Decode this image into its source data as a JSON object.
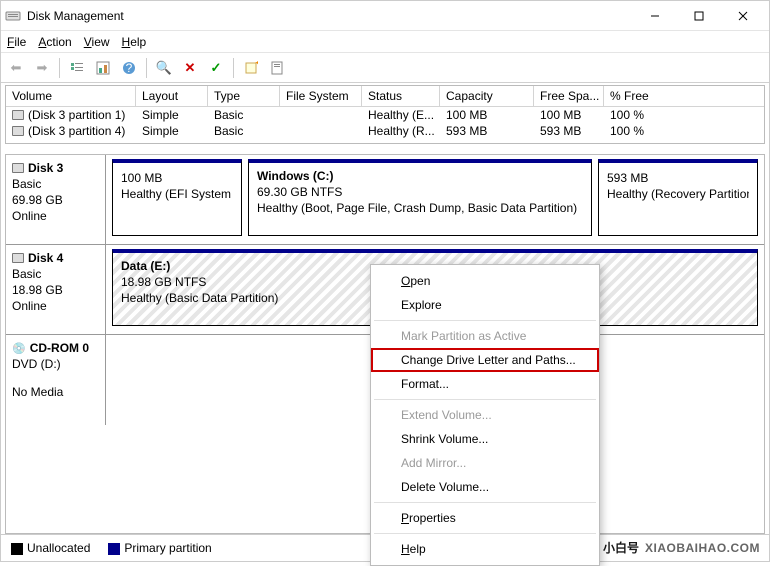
{
  "window": {
    "title": "Disk Management"
  },
  "menu": {
    "file": "File",
    "action": "Action",
    "view": "View",
    "help": "Help"
  },
  "columns": {
    "volume": "Volume",
    "layout": "Layout",
    "type": "Type",
    "filesystem": "File System",
    "status": "Status",
    "capacity": "Capacity",
    "freespace": "Free Spa...",
    "pctfree": "% Free"
  },
  "rows": [
    {
      "volume": "(Disk 3 partition 1)",
      "layout": "Simple",
      "type": "Basic",
      "filesystem": "",
      "status": "Healthy (E...",
      "capacity": "100 MB",
      "freespace": "100 MB",
      "pctfree": "100 %"
    },
    {
      "volume": "(Disk 3 partition 4)",
      "layout": "Simple",
      "type": "Basic",
      "filesystem": "",
      "status": "Healthy (R...",
      "capacity": "593 MB",
      "freespace": "593 MB",
      "pctfree": "100 %"
    }
  ],
  "disks": {
    "d3": {
      "name": "Disk 3",
      "type": "Basic",
      "size": "69.98 GB",
      "state": "Online",
      "parts": [
        {
          "name": "",
          "size": "100 MB",
          "status": "Healthy (EFI System Pa"
        },
        {
          "name": "Windows  (C:)",
          "size": "69.30 GB NTFS",
          "status": "Healthy (Boot, Page File, Crash Dump, Basic Data Partition)"
        },
        {
          "name": "",
          "size": "593 MB",
          "status": "Healthy (Recovery Partition)"
        }
      ]
    },
    "d4": {
      "name": "Disk 4",
      "type": "Basic",
      "size": "18.98 GB",
      "state": "Online",
      "parts": [
        {
          "name": "Data  (E:)",
          "size": "18.98 GB NTFS",
          "status": "Healthy (Basic Data Partition)"
        }
      ]
    },
    "cd": {
      "name": "CD-ROM 0",
      "type": "DVD (D:)",
      "size": "",
      "state": "No Media"
    }
  },
  "legend": {
    "unalloc": "Unallocated",
    "primary": "Primary partition"
  },
  "ctx": {
    "open": "Open",
    "explore": "Explore",
    "mark": "Mark Partition as Active",
    "change": "Change Drive Letter and Paths...",
    "format": "Format...",
    "extend": "Extend Volume...",
    "shrink": "Shrink Volume...",
    "mirror": "Add Mirror...",
    "delete": "Delete Volume...",
    "props": "Properties",
    "help": "Help"
  },
  "wm": {
    "cn": "小白号",
    "en": "XIAOBAIHAO.COM"
  }
}
